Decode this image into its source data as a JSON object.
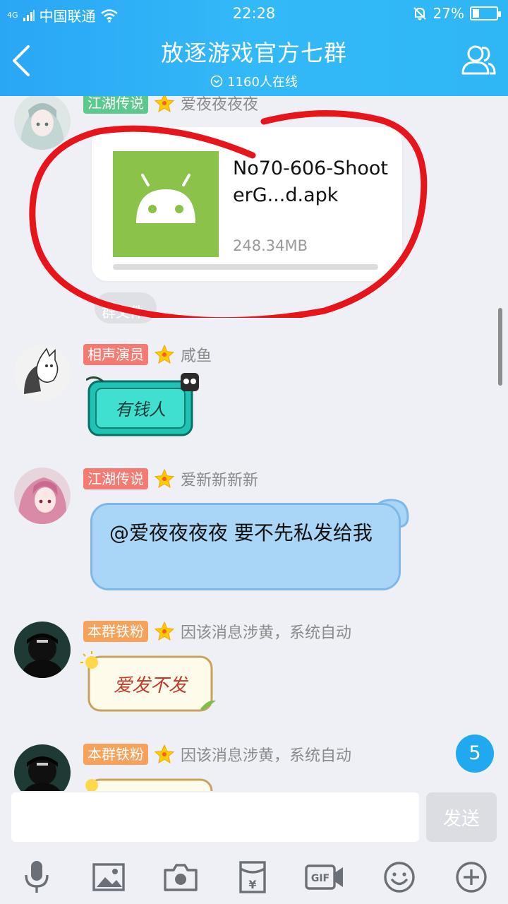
{
  "status": {
    "network": "4G",
    "carrier": "中国联通",
    "time": "22:28",
    "battery": "27%"
  },
  "header": {
    "title": "放逐游戏官方七群",
    "online": "1160人在线"
  },
  "messages": [
    {
      "badge": "江湖传说",
      "nick": "爱夜夜夜夜",
      "file": {
        "name": "No70-606-ShooterG...d.apk",
        "size": "248.34MB"
      },
      "system_chip": "群文件"
    },
    {
      "badge": "相声演员",
      "nick": "咸鱼",
      "sticker": "有钱人"
    },
    {
      "badge": "江湖传说",
      "nick": "爱新新新新",
      "text": "@爱夜夜夜夜 要不先私发给我"
    },
    {
      "badge": "本群铁粉",
      "nick": "因该消息涉黄，系统自动",
      "sticker": "爱发不发"
    },
    {
      "badge": "本群铁粉",
      "nick": "因该消息涉黄，系统自动"
    }
  ],
  "unread_count": "5",
  "input": {
    "value": "",
    "placeholder": "",
    "send_label": "发送"
  },
  "toolbar": [
    "mic-icon",
    "image-icon",
    "camera-icon",
    "red-packet-icon",
    "gif-icon",
    "emoji-icon",
    "plus-icon"
  ],
  "colors": {
    "header": "#2fb2f6",
    "badge_green": "#5ac98b",
    "badge_red": "#f57a72",
    "badge_orange": "#f7a25a",
    "bubble": "#a9d6f7",
    "annotation": "#e8141b"
  }
}
